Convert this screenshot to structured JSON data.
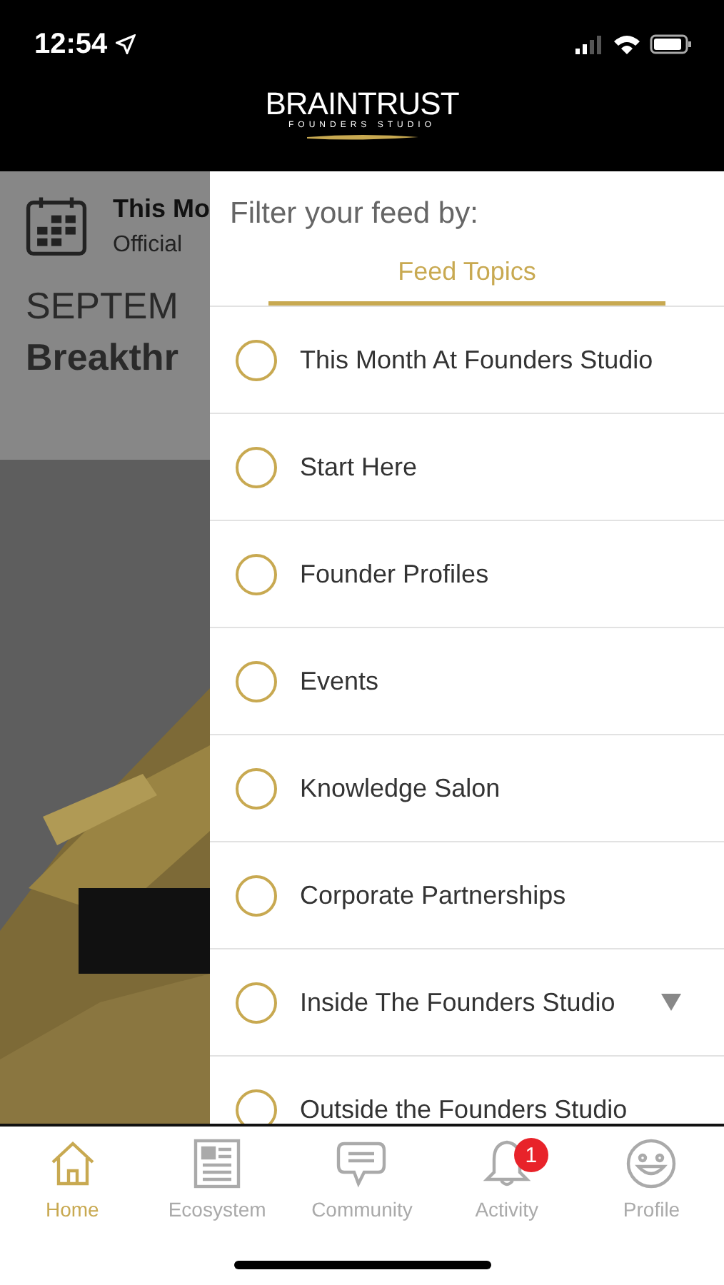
{
  "status_bar": {
    "time": "12:54"
  },
  "header": {
    "logo_title": "BRAINTRUST",
    "logo_subtitle": "FOUNDERS STUDIO"
  },
  "feed_behind": {
    "card_title": "This Mo",
    "card_subtitle": "Official",
    "headline_line_1": "SEPTEM",
    "headline_line_2": "Breakthr"
  },
  "filter_drawer": {
    "title": "Filter your feed by:",
    "tabs": [
      {
        "label": "Feed Topics",
        "selected": true
      }
    ],
    "topics": [
      {
        "label": "This Month At Founders Studio",
        "selected": false,
        "has_children": false
      },
      {
        "label": "Start Here",
        "selected": false,
        "has_children": false
      },
      {
        "label": "Founder Profiles",
        "selected": false,
        "has_children": false
      },
      {
        "label": "Events",
        "selected": false,
        "has_children": false
      },
      {
        "label": "Knowledge Salon",
        "selected": false,
        "has_children": false
      },
      {
        "label": "Corporate Partnerships",
        "selected": false,
        "has_children": false
      },
      {
        "label": "Inside The Founders Studio",
        "selected": false,
        "has_children": true
      },
      {
        "label": "Outside the Founders Studio",
        "selected": false,
        "has_children": false
      }
    ]
  },
  "tab_bar": [
    {
      "label": "Home",
      "kind": "home",
      "selected": true
    },
    {
      "label": "Ecosystem",
      "kind": "news",
      "selected": false
    },
    {
      "label": "Community",
      "kind": "chat",
      "selected": false
    },
    {
      "label": "Activity",
      "kind": "bell",
      "selected": false,
      "badge": "1"
    },
    {
      "label": "Profile",
      "kind": "face",
      "selected": false
    }
  ]
}
